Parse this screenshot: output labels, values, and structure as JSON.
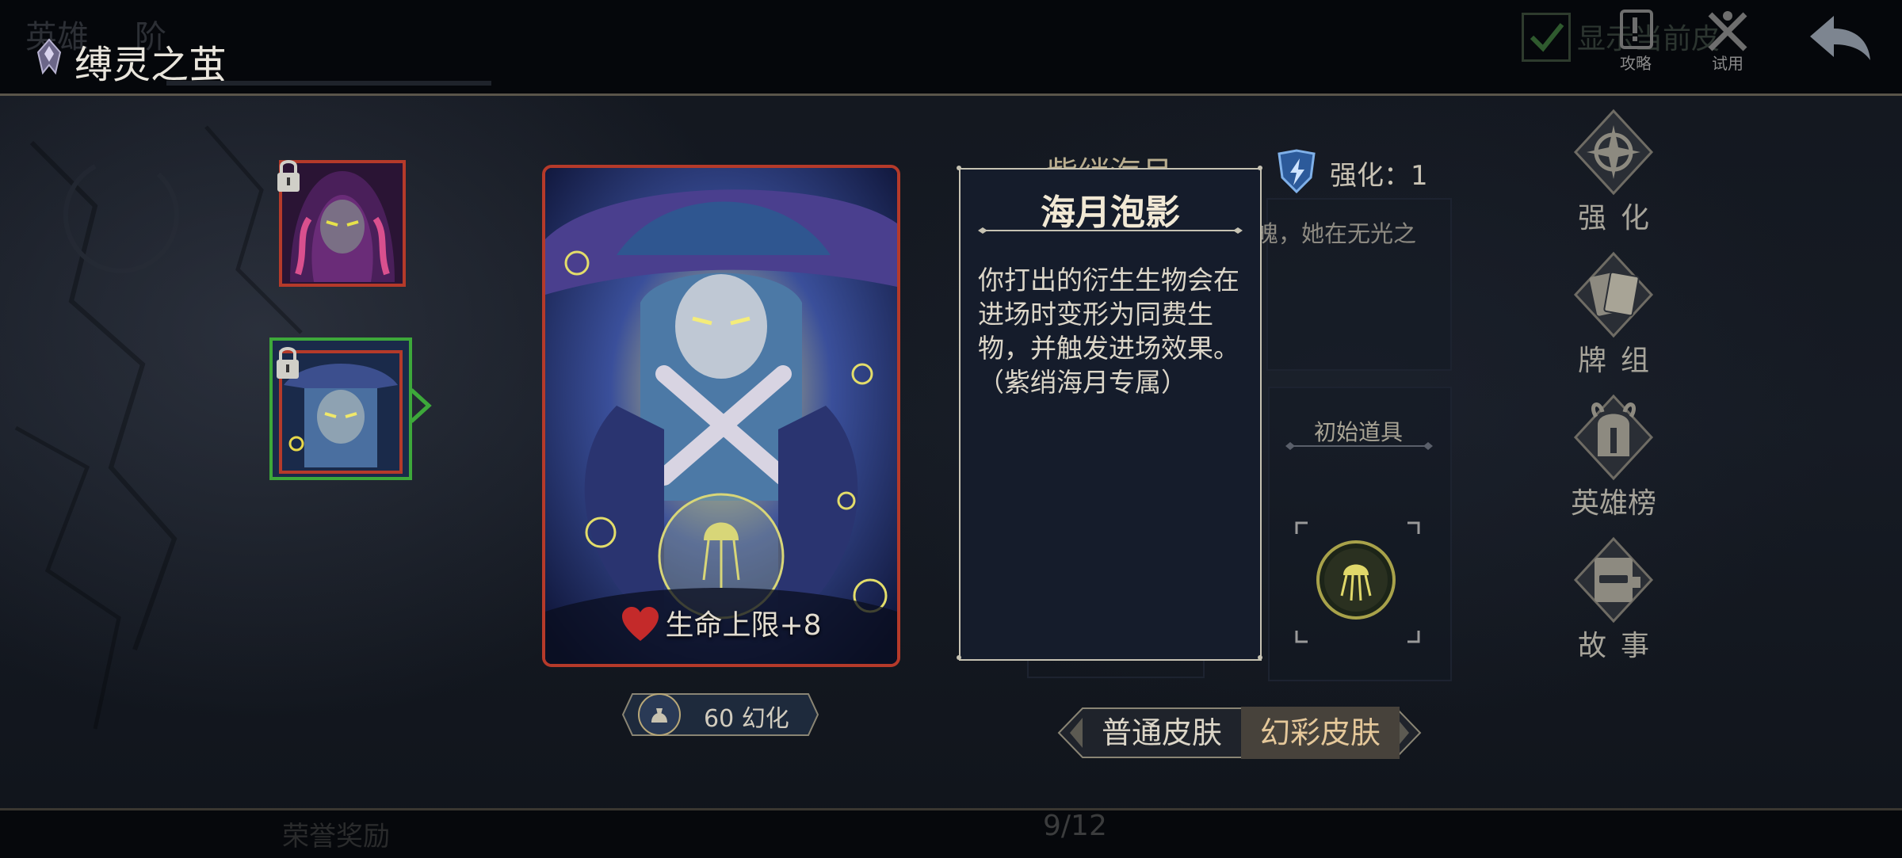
{
  "header": {
    "title": "缚灵之茧",
    "ghost_tab_1": "英雄",
    "ghost_tab_2": "阶",
    "show_current_label": "显示当前皮",
    "guide_label": "攻略",
    "trial_label": "试用"
  },
  "card": {
    "stat_text": "生命上限+8",
    "price_value": "60",
    "price_unit": "幻化"
  },
  "tooltip": {
    "title": "海月泡影",
    "body": "你打出的衍生生物会在进场时变形为同费生物，并触发进场效果。（紫绡海月专属）"
  },
  "info": {
    "hero_name": "紫绡海月",
    "enhance_label": "强化：1",
    "lore_snippet": "魄，她在无光之",
    "starting_item_label": "初始道具"
  },
  "skin_toggle": {
    "normal": "普通皮肤",
    "illusion": "幻彩皮肤",
    "selected": "幻彩皮肤"
  },
  "side_menu": {
    "enhance": "强化",
    "deck": "牌组",
    "ranking": "英雄榜",
    "story": "故事"
  },
  "footer": {
    "honor_reward": "荣誉奖励",
    "page_indicator": "9/12"
  },
  "colors": {
    "selected_border": "#3da83a",
    "card_border": "#b53a2a",
    "accent_gold": "#e5c89a"
  }
}
